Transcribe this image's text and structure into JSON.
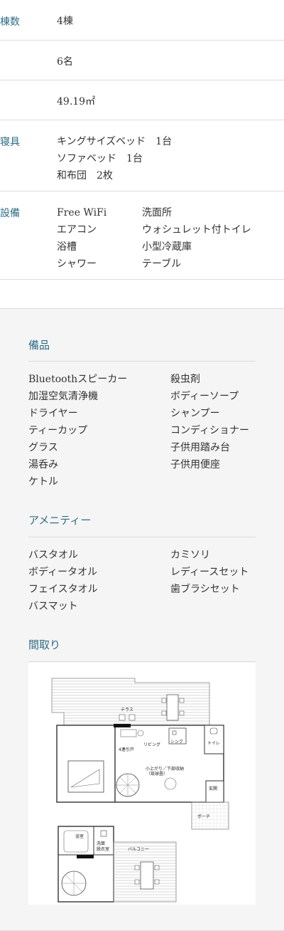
{
  "spec": {
    "buildings": {
      "label": "棟数",
      "value": "4棟"
    },
    "capacity": {
      "label": "",
      "value": "6名"
    },
    "area": {
      "label": "",
      "value": "49.19㎡"
    },
    "bedding": {
      "label": "寝具",
      "lines": [
        "キングサイズベッド　1台",
        "ソファベッド　1台",
        "和布団　2枚"
      ]
    },
    "facilities": {
      "label": "設備",
      "col1": [
        "Free WiFi",
        "エアコン",
        "浴槽",
        "シャワー"
      ],
      "col2": [
        "洗面所",
        "ウォシュレット付トイレ",
        "小型冷蔵庫",
        "テーブル"
      ]
    }
  },
  "equipment": {
    "title": "備品",
    "col1": [
      "Bluetoothスピーカー",
      "加湿空気清浄機",
      "ドライヤー",
      "ティーカップ",
      "グラス",
      "湯呑み",
      "ケトル"
    ],
    "col2": [
      "殺虫剤",
      "ボディーソープ",
      "シャンプー",
      "コンディショナー",
      "子供用踏み台",
      "子供用便座"
    ]
  },
  "amenity": {
    "title": "アメニティー",
    "col1": [
      "バスタオル",
      "ボディータオル",
      "フェイスタオル",
      "バスマット"
    ],
    "col2": [
      "カミソリ",
      "レディースセット",
      "歯ブラシセット"
    ]
  },
  "floorplan": {
    "title": "間取り",
    "labels": {
      "terrace": "テラス",
      "living": "リビング",
      "sink": "シンク",
      "toilet": "トイレ",
      "sliding": "4連引戸",
      "raised": "小上がり／下部収納",
      "raised_sub": "（琉球畳）",
      "entrance": "玄関",
      "porch": "ポーチ",
      "bath": "浴室",
      "washroom": "洗面",
      "dressing": "脱衣室",
      "balcony": "バルコニー"
    }
  }
}
